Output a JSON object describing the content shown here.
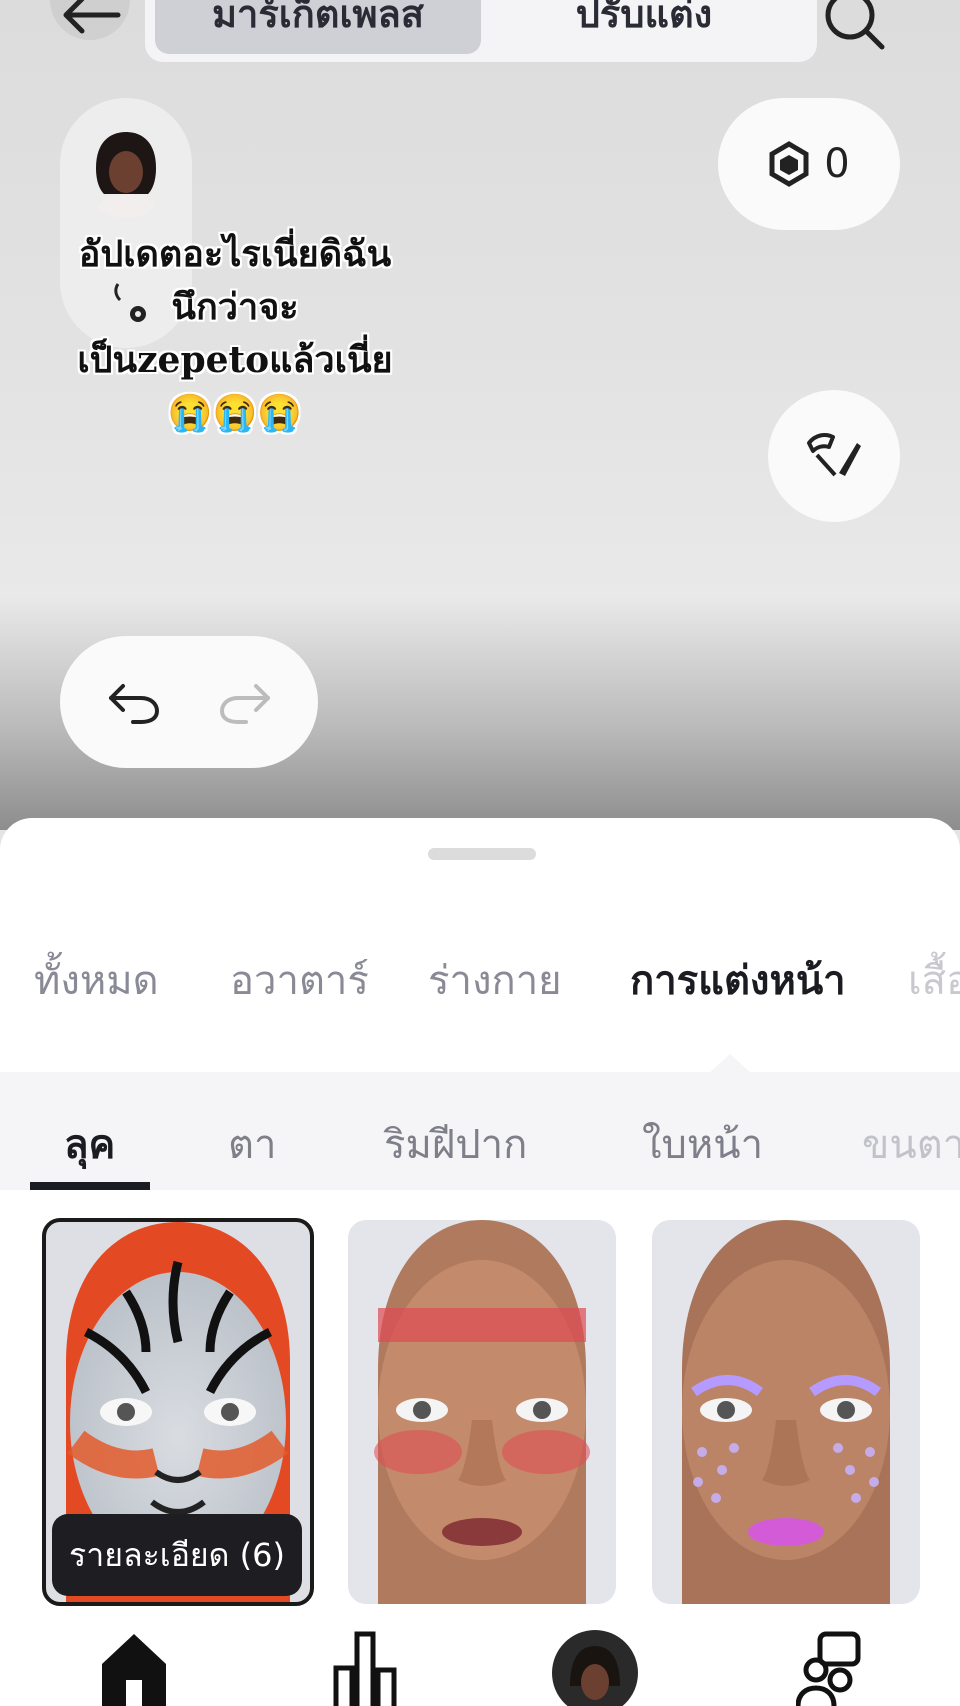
{
  "header": {
    "segments": [
      "มาร์เก็ตเพลส",
      "ปรับแต่ง"
    ],
    "active_segment": 0
  },
  "currency": {
    "count": "0",
    "icon": "hexagon-coin-icon"
  },
  "caption": {
    "lines": [
      "อัปเดตอะไรเนี่ยดิฉัน",
      "นึกว่าจะ",
      "เป็นzepetoแล้วเนี่ย",
      "😭😭😭"
    ]
  },
  "categories": {
    "items": [
      "ทั้งหมด",
      "อวาตาร์",
      "ร่างกาย",
      "การแต่งหน้า",
      "เสื้อ"
    ],
    "active": "การแต่งหน้า"
  },
  "subcategories": {
    "items": [
      "ลุค",
      "ตา",
      "ริมฝีปาก",
      "ใบหน้า",
      "ขนตา"
    ],
    "active": "ลุค"
  },
  "looks": [
    {
      "name": "tiger-face-paint",
      "selected": true,
      "detail_label": "รายละเอียด (6)"
    },
    {
      "name": "red-stripe-blush",
      "selected": false
    },
    {
      "name": "lilac-glitter-freckles",
      "selected": false
    }
  ],
  "nav": {
    "items": [
      "home-icon",
      "ranking-icon",
      "profile-avatar",
      "friends-icon"
    ]
  },
  "colors": {
    "accent": "#1b1b22",
    "tab_inactive": "#8a8a96",
    "sheet": "#ffffff"
  }
}
